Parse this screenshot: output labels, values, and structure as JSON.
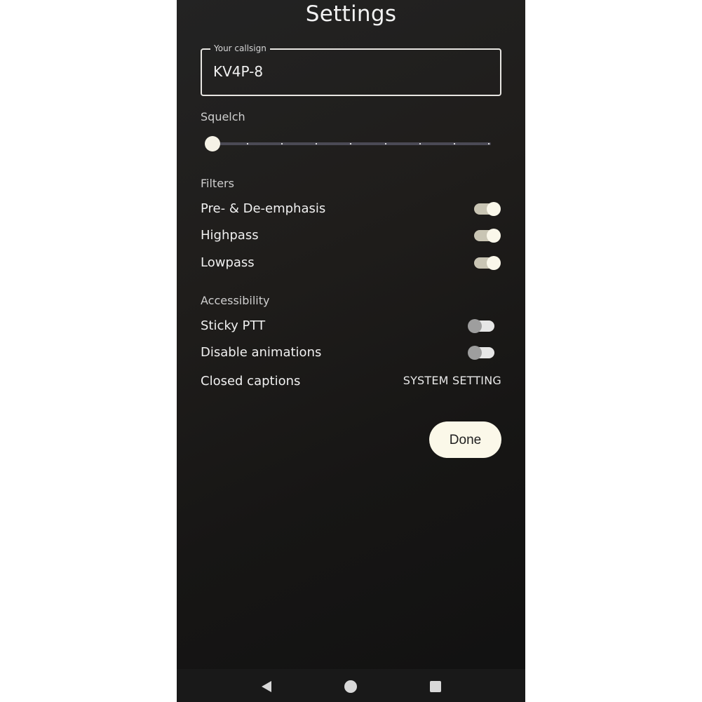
{
  "header": {
    "title": "Settings"
  },
  "callsign": {
    "label": "Your callsign",
    "value": "KV4P-8"
  },
  "squelch": {
    "label": "Squelch",
    "value": 0,
    "min": 0,
    "max": 8
  },
  "filters": {
    "label": "Filters",
    "items": [
      {
        "label": "Pre- & De-emphasis",
        "on": true
      },
      {
        "label": "Highpass",
        "on": true
      },
      {
        "label": "Lowpass",
        "on": true
      }
    ]
  },
  "accessibility": {
    "label": "Accessibility",
    "items": [
      {
        "label": "Sticky PTT",
        "on": false
      },
      {
        "label": "Disable animations",
        "on": false
      }
    ],
    "closed_captions": {
      "label": "Closed captions",
      "value": "SYSTEM SETTING"
    }
  },
  "actions": {
    "done_label": "Done"
  },
  "navbar": {
    "icons": [
      "back-icon",
      "home-icon",
      "recents-icon"
    ]
  }
}
